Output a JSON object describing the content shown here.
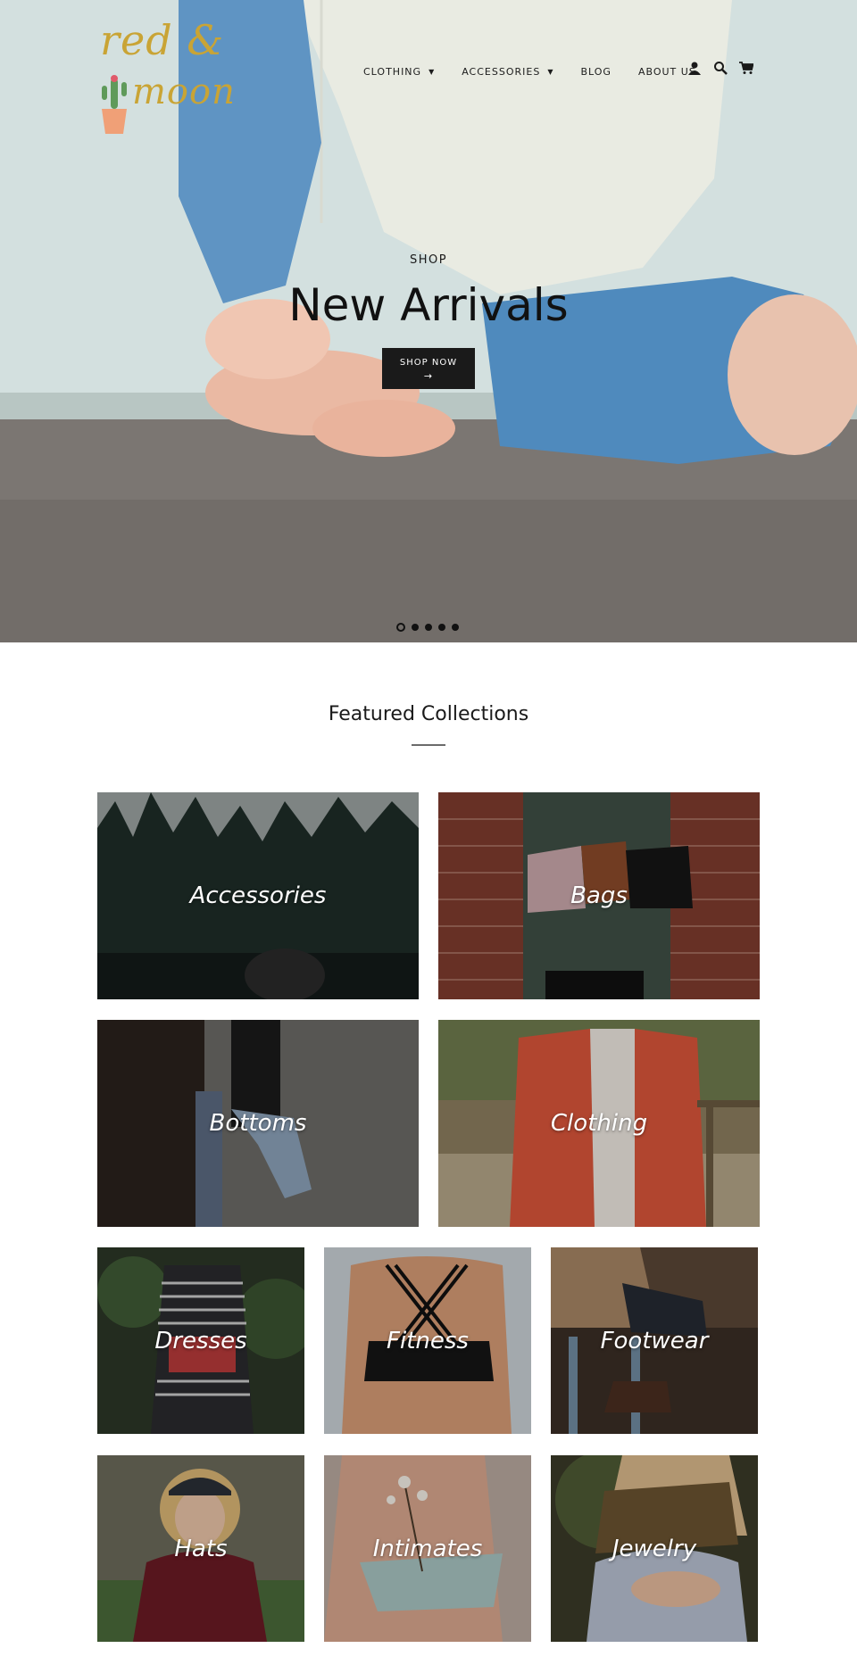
{
  "brand": {
    "logo_line1": "red &",
    "logo_line2": "moon"
  },
  "nav": {
    "items": [
      {
        "label": "CLOTHING",
        "has_dropdown": true
      },
      {
        "label": "ACCESSORIES",
        "has_dropdown": true
      },
      {
        "label": "BLOG",
        "has_dropdown": false
      },
      {
        "label": "ABOUT US",
        "has_dropdown": false
      }
    ],
    "icons": [
      "account-icon",
      "search-icon",
      "cart-icon"
    ]
  },
  "hero": {
    "subtitle": "SHOP",
    "title": "New Arrivals",
    "button_label": "SHOP NOW",
    "button_arrow": "→",
    "slides_count": 5,
    "active_slide": 1
  },
  "featured": {
    "title": "Featured Collections",
    "collections": [
      {
        "label": "Accessories"
      },
      {
        "label": "Bags"
      },
      {
        "label": "Bottoms"
      },
      {
        "label": "Clothing"
      },
      {
        "label": "Dresses"
      },
      {
        "label": "Fitness"
      },
      {
        "label": "Footwear"
      },
      {
        "label": "Hats"
      },
      {
        "label": "Intimates"
      },
      {
        "label": "Jewelry"
      }
    ]
  },
  "colors": {
    "accent": "#c9a435",
    "button": "#1a1a1a"
  }
}
